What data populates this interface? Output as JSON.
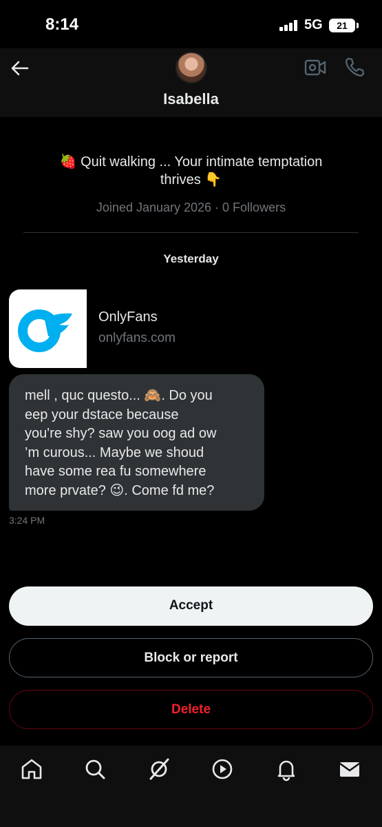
{
  "status_bar": {
    "time": "8:14",
    "network": "5G",
    "battery": "21"
  },
  "header": {
    "contact_name": "Isabella"
  },
  "profile": {
    "bio_line1": "🍓 Quit walking ... Your intimate temptation",
    "bio_line2": "thrives 👇",
    "meta": "Joined January 2026 · 0 Followers"
  },
  "date_separator": "Yesterday",
  "link_card": {
    "title": "OnlyFans",
    "domain": "onlyfans.com"
  },
  "message": {
    "text": "mell , quc questo... 🙈. Do you\neep your dstace because\nyou're shy?  saw you oog ad ow\n’m curous... Maybe we shoud\nhave some rea fu somewhere\nmore prvate? 😉. Come fd me?",
    "time": "3:24 PM"
  },
  "actions": {
    "accept": "Accept",
    "block": "Block or report",
    "delete": "Delete"
  },
  "nav": [
    "home-icon",
    "search-icon",
    "grok-icon",
    "video-icon",
    "notifications-icon",
    "messages-icon"
  ],
  "colors": {
    "onlyfans_blue": "#00AFF0",
    "delete_red": "#F4212E"
  }
}
